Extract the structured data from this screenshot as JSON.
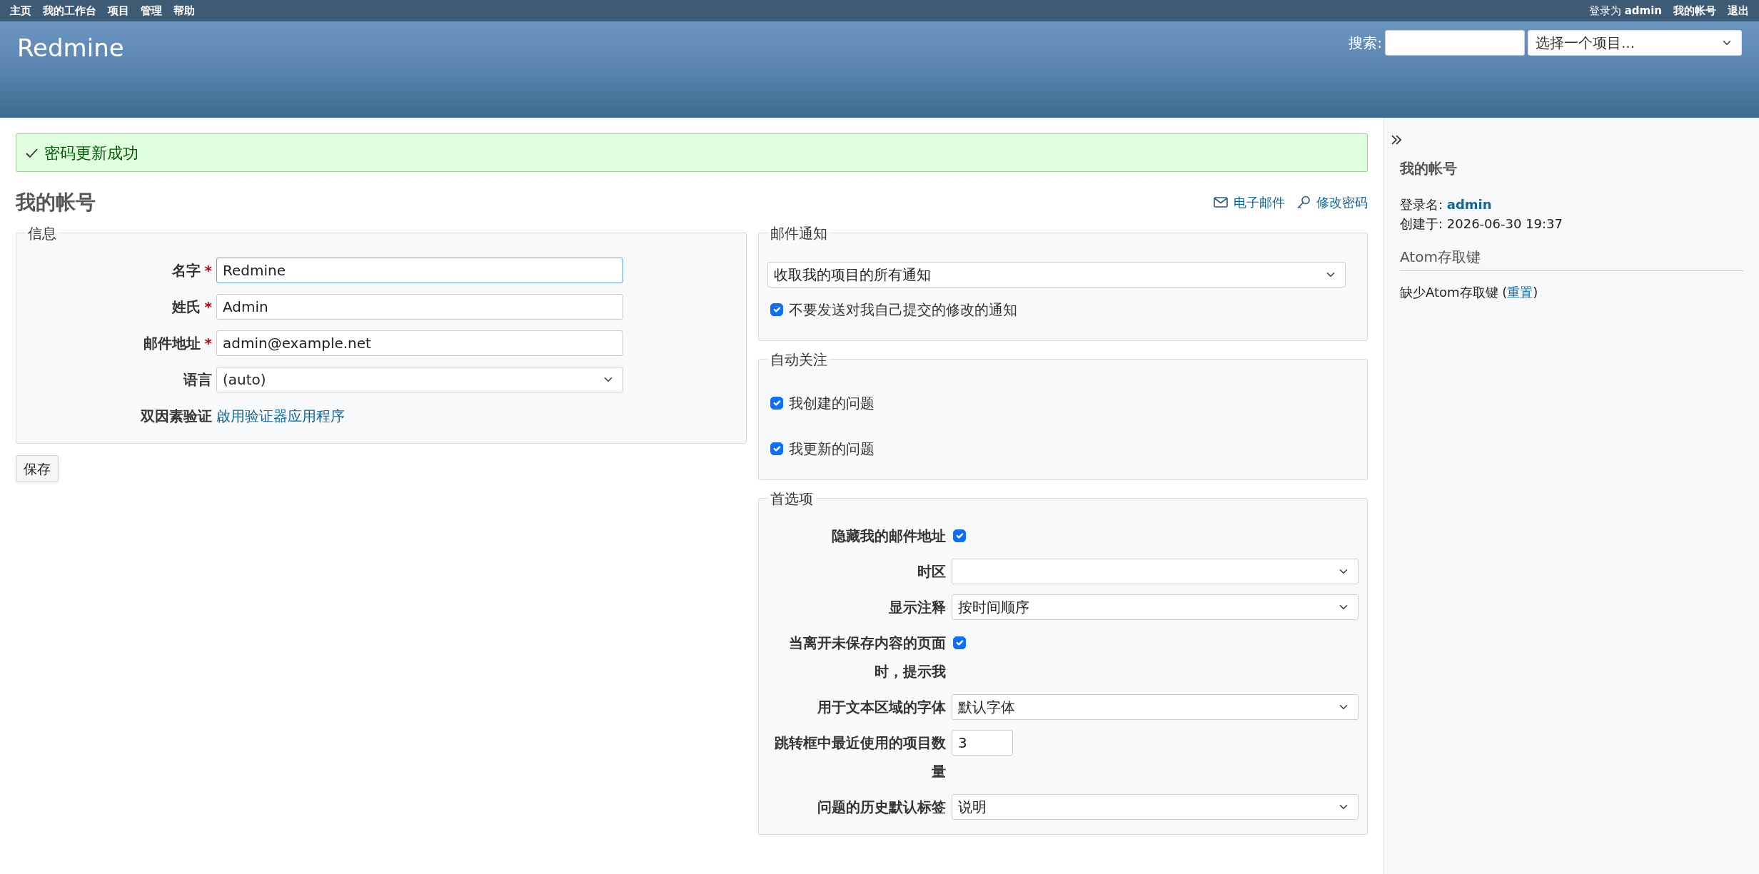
{
  "top_menu": {
    "items": [
      "主页",
      "我的工作台",
      "项目",
      "管理",
      "帮助"
    ],
    "logged_in": "登录为 **admin**",
    "account_items": [
      "我的帐号",
      "退出"
    ]
  },
  "header": {
    "title": "Redmine",
    "search_label": "搜索:",
    "project_jump": "选择一个项目..."
  },
  "flash": {
    "kind": "notice",
    "text": "密码更新成功"
  },
  "page_title": "我的帐号",
  "contextual_links": [
    {
      "kind": "mail",
      "label": "电子邮件"
    },
    {
      "kind": "key",
      "label": "修改密码"
    }
  ],
  "info": {
    "legend": "信息",
    "fields": [
      {
        "kind": "text",
        "label": "名字",
        "required_mark": "*",
        "value": "Redmine",
        "focused": true
      },
      {
        "kind": "text",
        "label": "姓氏",
        "required_mark": "*",
        "value": "Admin",
        "focused": false
      },
      {
        "kind": "text",
        "label": "邮件地址",
        "required_mark": "*",
        "value": "admin@example.net",
        "focused": false
      },
      {
        "kind": "select",
        "label": "语言",
        "value": "(auto)",
        "focused": false
      },
      {
        "kind": "link",
        "label": "双因素验证",
        "value": "啟用验证器应用程序",
        "focused": false
      }
    ]
  },
  "save_button": "保存",
  "mail_notification": {
    "legend": "邮件通知",
    "select": "收取我的项目的所有通知",
    "options": [
      {
        "label": "不要发送对我自己提交的修改的通知",
        "checked": true
      }
    ]
  },
  "auto_watch": {
    "legend": "自动关注",
    "options": [
      {
        "label": "我创建的问题",
        "checked": true
      },
      {
        "label": "我更新的问题",
        "checked": true
      }
    ]
  },
  "preferences": {
    "legend": "首选项",
    "fields": [
      {
        "kind": "checkbox",
        "label": "隐藏我的邮件地址",
        "checked": true
      },
      {
        "kind": "select",
        "label": "时区"
      },
      {
        "kind": "select",
        "label": "显示注释",
        "value": "按时间顺序"
      },
      {
        "kind": "checkbox",
        "label": "当离开未保存内容的页面时，提示我",
        "checked": true
      },
      {
        "kind": "select",
        "label": "用于文本区域的字体",
        "value": "默认字体"
      },
      {
        "kind": "number",
        "label": "跳转框中最近使用的项目数量",
        "value": "3"
      },
      {
        "kind": "select",
        "label": "问题的历史默认标签",
        "value": "说明"
      }
    ]
  },
  "sidebar": {
    "title": "我的帐号",
    "login_label": "登录名:",
    "login": "admin",
    "created": "创建于: 2026-06-30 19:37",
    "atom_heading": "Atom存取键",
    "atom_text": "缺少Atom存取键 (",
    "atom_link": "重置",
    "atom_text_end": ")"
  }
}
